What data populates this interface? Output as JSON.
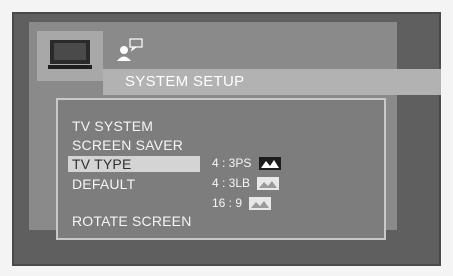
{
  "title": "SYSTEM SETUP",
  "tabs": [
    {
      "icon": "monitor-icon",
      "selected": true
    },
    {
      "icon": "user-speech-icon",
      "selected": false
    }
  ],
  "menu": {
    "items": [
      {
        "label": "TV SYSTEM",
        "selected": false
      },
      {
        "label": "SCREEN SAVER",
        "selected": false
      },
      {
        "label": "TV TYPE",
        "selected": true
      },
      {
        "label": "DEFAULT",
        "selected": false
      },
      {
        "label": "ROTATE SCREEN",
        "selected": false
      }
    ]
  },
  "options": [
    {
      "label": "4 : 3PS",
      "icon": "pan-scan-thumbnail",
      "highlighted": true
    },
    {
      "label": "4 : 3LB",
      "icon": "letterbox-thumbnail",
      "highlighted": false
    },
    {
      "label": "16 : 9",
      "icon": "widescreen-thumbnail",
      "highlighted": false
    }
  ]
}
